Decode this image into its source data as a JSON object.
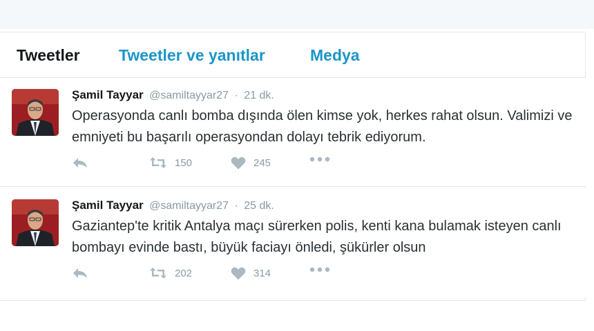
{
  "tabs": [
    {
      "label": "Tweetler",
      "active": true
    },
    {
      "label": "Tweetler ve yanıtlar",
      "active": false
    },
    {
      "label": "Medya",
      "active": false
    }
  ],
  "tweets": [
    {
      "name": "Şamil Tayyar",
      "handle": "@samiltayyar27",
      "dot": "·",
      "time": "21 dk.",
      "text": "Operasyonda canlı bomba dışında ölen kimse yok, herkes rahat olsun. Valimizi ve emniyeti bu başarılı operasyondan dolayı tebrik ediyorum.",
      "retweets": "150",
      "likes": "245"
    },
    {
      "name": "Şamil Tayyar",
      "handle": "@samiltayyar27",
      "dot": "·",
      "time": "25 dk.",
      "text": "Gaziantep'te kritik Antalya maçı sürerken polis, kenti kana bulamak isteyen canlı bombayı evinde bastı, büyük faciayı önledi, şükürler olsun",
      "retweets": "202",
      "likes": "314"
    }
  ],
  "icons": {
    "reply": "reply-icon",
    "retweet": "retweet-icon",
    "like": "heart-icon",
    "more": "more-dots-icon"
  },
  "colors": {
    "tab_link": "#1b95c8",
    "tab_active": "#14171a",
    "muted": "#8899a6",
    "icon": "#aab8c2"
  }
}
